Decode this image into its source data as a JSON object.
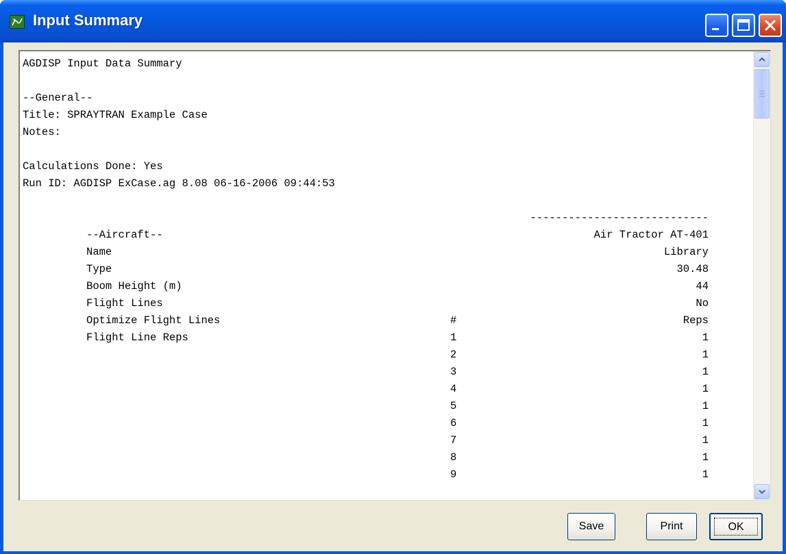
{
  "window": {
    "title": "Input Summary",
    "icon": "agdisp-app-icon"
  },
  "summary": {
    "heading": "AGDISP Input Data Summary",
    "general_header": "--General--",
    "title_line": "Title: SPRAYTRAN Example Case",
    "notes_line": "Notes:",
    "calc_line": "Calculations Done: Yes",
    "runid_line": "Run ID: AGDISP ExCase.ag 8.08 06-16-2006 09:44:53",
    "aircraft_header": "--Aircraft--",
    "aircraft_divider": "----------------------------",
    "rows": [
      {
        "label": "Name",
        "value": "Air Tractor AT-401"
      },
      {
        "label": "Type",
        "value": "Library"
      },
      {
        "label": "Boom Height (m)",
        "value": "30.48"
      },
      {
        "label": "Flight Lines",
        "value": "44"
      },
      {
        "label": "Optimize Flight Lines",
        "value": "No"
      }
    ],
    "reps_label": "Flight Line Reps",
    "reps_col_num": "#",
    "reps_col_reps": "Reps",
    "reps": [
      {
        "n": "1",
        "reps": "1"
      },
      {
        "n": "2",
        "reps": "1"
      },
      {
        "n": "3",
        "reps": "1"
      },
      {
        "n": "4",
        "reps": "1"
      },
      {
        "n": "5",
        "reps": "1"
      },
      {
        "n": "6",
        "reps": "1"
      },
      {
        "n": "7",
        "reps": "1"
      },
      {
        "n": "8",
        "reps": "1"
      },
      {
        "n": "9",
        "reps": "1"
      }
    ]
  },
  "buttons": {
    "save": "Save",
    "print": "Print",
    "ok": "OK"
  }
}
